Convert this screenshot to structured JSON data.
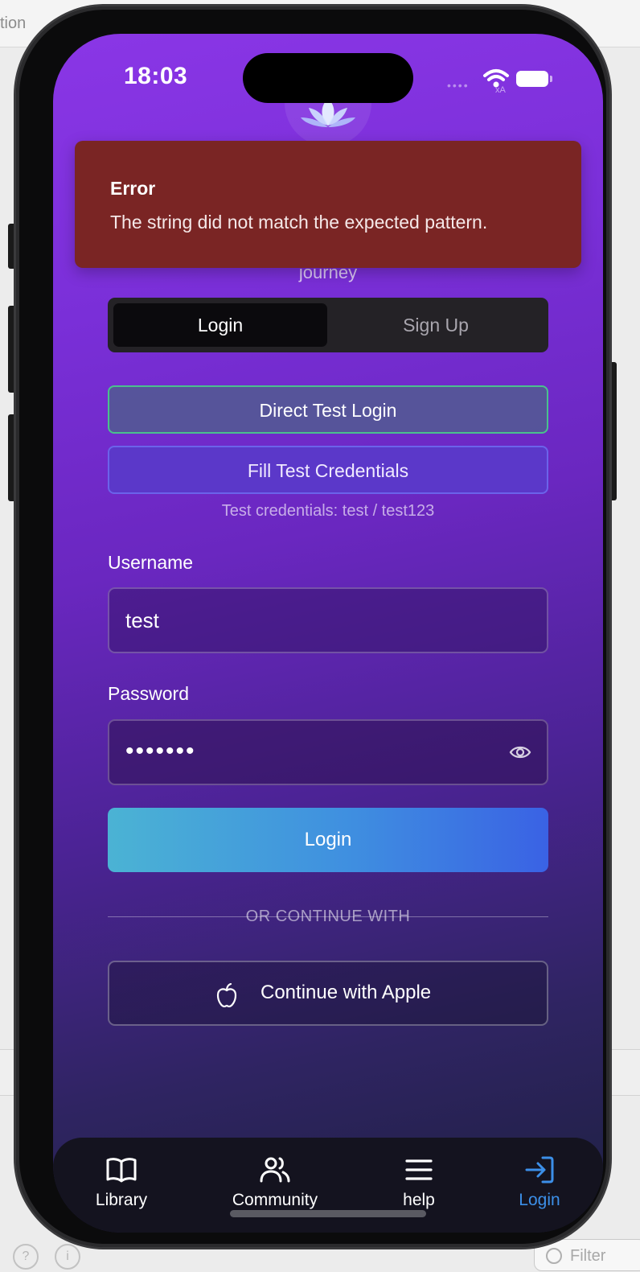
{
  "backdrop": {
    "top_label": "tion",
    "filter_placeholder": "Filter"
  },
  "status_bar": {
    "time": "18:03",
    "signal": "••••",
    "wifi_icon": "wifi-icon",
    "battery_icon": "battery-icon"
  },
  "header": {
    "subtitle": "journey",
    "logo_icon": "lotus-icon"
  },
  "error_toast": {
    "title": "Error",
    "message": "The string did not match the expected pattern."
  },
  "auth_tabs": {
    "login": "Login",
    "signup": "Sign Up",
    "selected": "Login"
  },
  "test_buttons": {
    "direct_login": "Direct Test Login",
    "fill_credentials": "Fill Test Credentials",
    "hint": "Test credentials: test / test123"
  },
  "form": {
    "username_label": "Username",
    "username_value": "test",
    "password_label": "Password",
    "password_masked": "•••••••",
    "show_password_icon": "eye-icon",
    "submit_label": "Login",
    "divider_text": "OR CONTINUE WITH",
    "apple_label": "Continue with Apple",
    "apple_icon": "apple-icon"
  },
  "tab_bar": {
    "items": [
      {
        "label": "Library",
        "icon": "book-icon"
      },
      {
        "label": "Community",
        "icon": "users-icon"
      },
      {
        "label": "help",
        "icon": "menu-icon"
      },
      {
        "label": "Login",
        "icon": "login-icon"
      }
    ],
    "active": "Login",
    "active_color": "#3c8fe8"
  },
  "colors": {
    "error_bg": "#7a2524",
    "gradient_top": "#8a36e6",
    "gradient_bottom": "#1d2040",
    "login_gradient_start": "#4bb3d4",
    "login_gradient_end": "#3a62e4",
    "direct_login_border": "#4ac08e"
  }
}
